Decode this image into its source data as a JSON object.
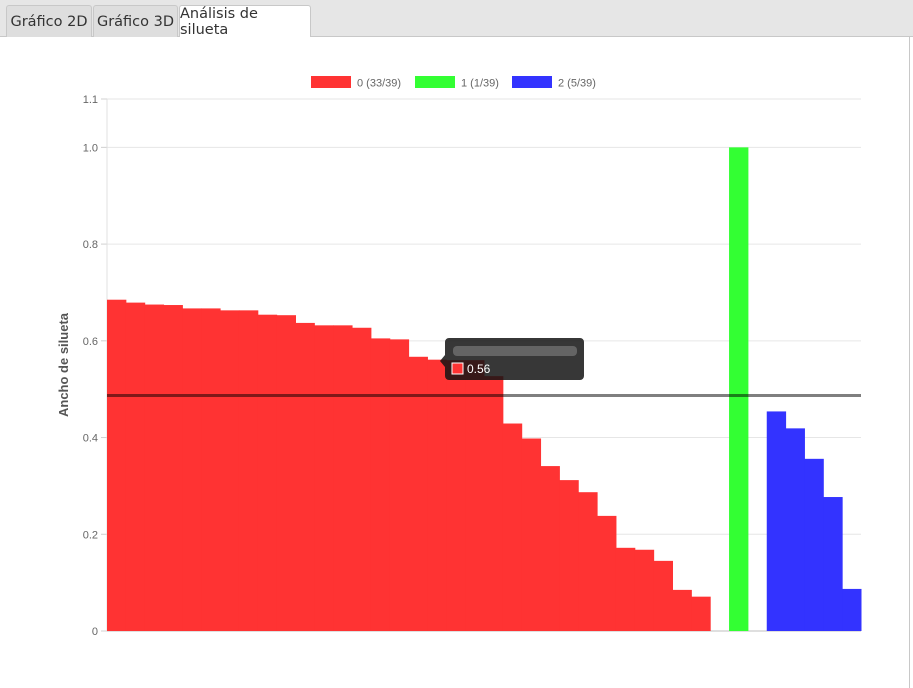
{
  "tabs": [
    {
      "label": "Gráfico 2D"
    },
    {
      "label": "Gráfico 3D"
    },
    {
      "label": "Análisis de silueta"
    }
  ],
  "active_tab": "Análisis de silueta",
  "tooltip": {
    "value_label": "0.56",
    "color": "#ff3333"
  },
  "chart_data": {
    "type": "bar",
    "ylabel": "Ancho de silueta",
    "xlabel": "",
    "ylim": [
      0,
      1.1
    ],
    "yticks": [
      "0",
      "0.2",
      "0.4",
      "0.6",
      "0.8",
      "1.0",
      "1.1"
    ],
    "ytick_values": [
      0,
      0.2,
      0.4,
      0.6,
      0.8,
      1.0,
      1.1
    ],
    "grid": true,
    "legend_position": "top",
    "average_line": 0.487,
    "series": [
      {
        "name": "0 (33/39)",
        "color": "#ff3333",
        "values": [
          0.685,
          0.679,
          0.675,
          0.674,
          0.667,
          0.667,
          0.663,
          0.663,
          0.654,
          0.653,
          0.637,
          0.632,
          0.632,
          0.627,
          0.605,
          0.603,
          0.567,
          0.561,
          0.56,
          0.56,
          0.527,
          0.429,
          0.398,
          0.341,
          0.312,
          0.287,
          0.238,
          0.172,
          0.168,
          0.145,
          0.085,
          0.071
        ]
      },
      {
        "name": "1 (1/39)",
        "color": "#33ff33",
        "values": [
          1.0
        ]
      },
      {
        "name": "2 (5/39)",
        "color": "#3333ff",
        "values": [
          0.454,
          0.419,
          0.356,
          0.277,
          0.087
        ]
      }
    ]
  }
}
